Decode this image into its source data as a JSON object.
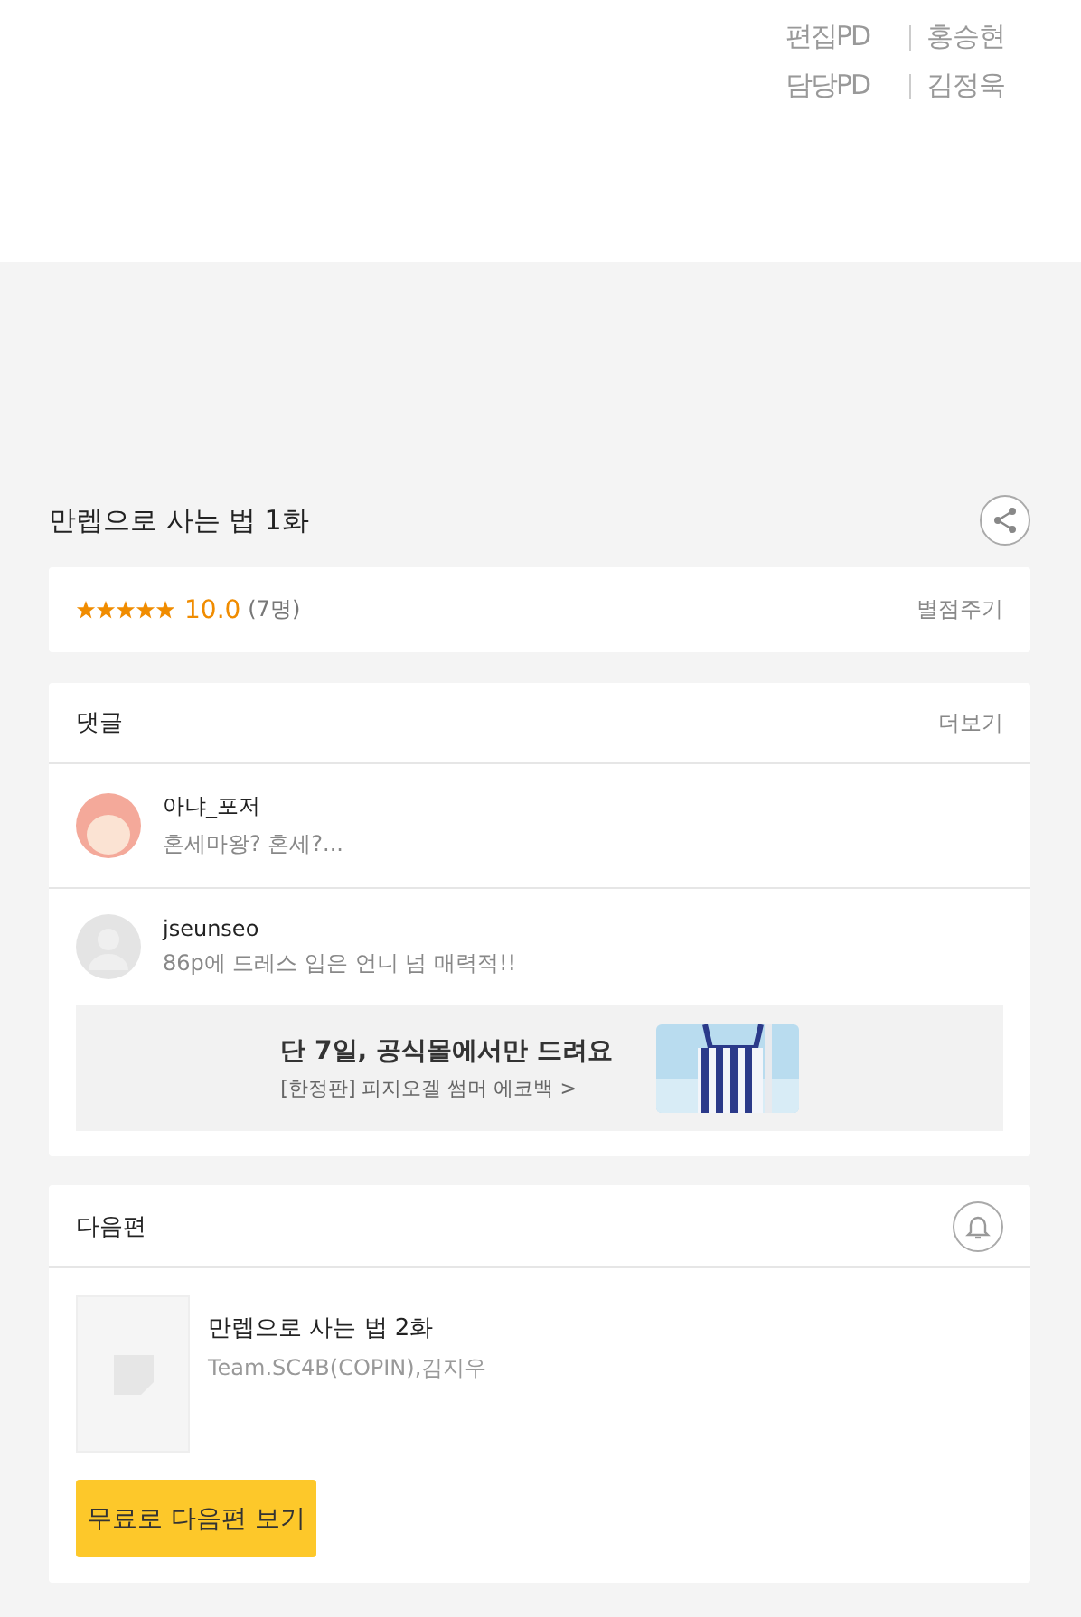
{
  "credits": [
    {
      "role": "편집PD",
      "name": "홍승현"
    },
    {
      "role": "담당PD",
      "name": "김정욱"
    }
  ],
  "episode": {
    "title": "만렙으로 사는 법 1화"
  },
  "rating": {
    "stars": 5,
    "score": "10.0",
    "count": "(7명)",
    "action": "별점주기"
  },
  "comments": {
    "title": "댓글",
    "more": "더보기",
    "items": [
      {
        "kind": "character",
        "user": "아냐_포저",
        "text": "혼세마왕? 혼세?..."
      },
      {
        "kind": "default",
        "user": "jseunseo",
        "text": "86p에 드레스 입은 언니 넘 매력적!!"
      }
    ]
  },
  "banner": {
    "headline": "단 7일, 공식몰에서만 드려요",
    "sub": "[한정판] 피지오겔 썸머 에코백 >"
  },
  "next": {
    "title": "다음편",
    "episode": "만렙으로 사는 법 2화",
    "authors": "Team.SC4B(COPIN),김지우",
    "button": "무료로 다음편 보기"
  }
}
